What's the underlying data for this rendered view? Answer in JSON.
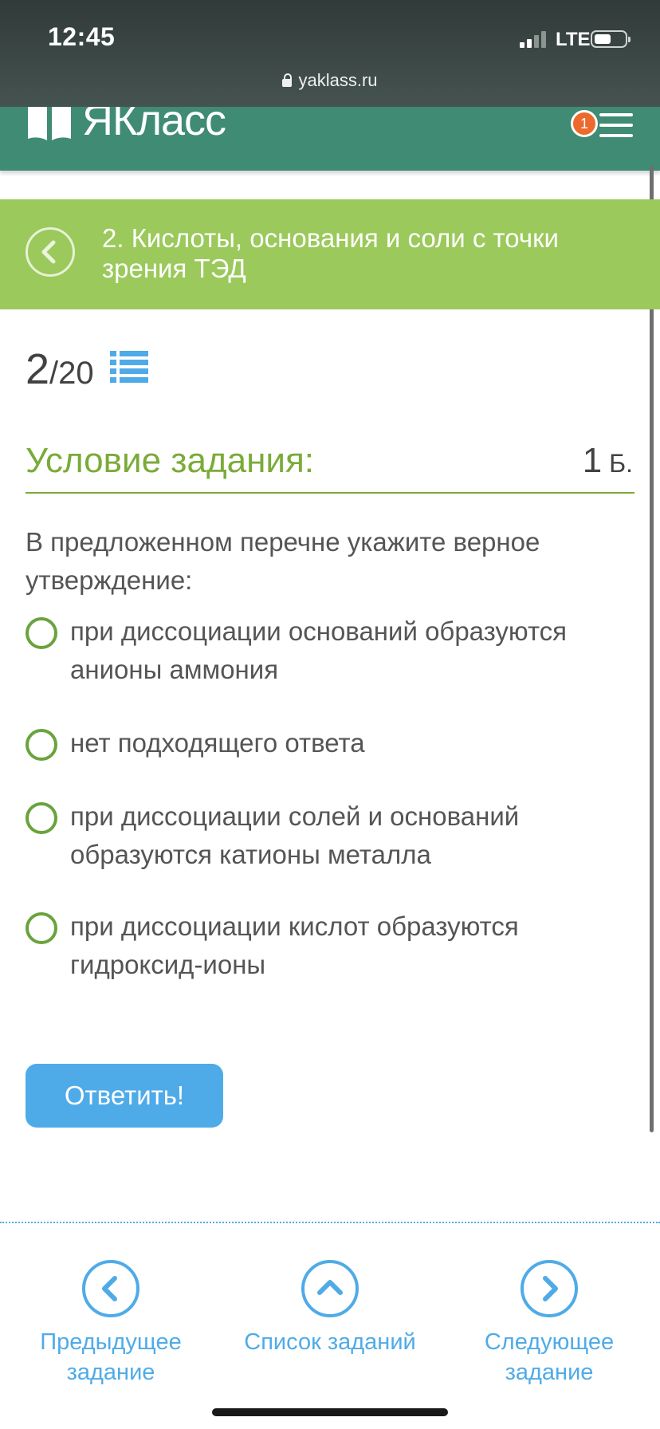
{
  "status_bar": {
    "time": "12:45",
    "network": "LTE"
  },
  "browser": {
    "url": "yaklass.ru"
  },
  "site": {
    "logo_text": "ЯКласс",
    "notification_count": "1",
    "brand_color": "#3f8b73"
  },
  "topic": {
    "title": "2. Кислоты, основания и соли с точки зрения ТЭД",
    "bar_color": "#9bc95b"
  },
  "task": {
    "current": "2",
    "total": "/20"
  },
  "condition": {
    "title": "Условие задания:",
    "points_value": "1",
    "points_unit": " Б."
  },
  "question": {
    "text": "В предложенном перечне укажите верное утверждение:",
    "options": [
      "при диссоциации оснований образуются анионы аммония",
      "нет подходящего ответа",
      "при диссоциации солей и оснований образуются катионы металла",
      "при диссоциации кислот образуются гидроксид-ионы"
    ]
  },
  "actions": {
    "submit_label": "Ответить!"
  },
  "navigation": {
    "prev_line1": "Предыдущее",
    "prev_line2": "задание",
    "list_label": "Список заданий",
    "next_line1": "Следующее",
    "next_line2": "задание"
  },
  "icons": {
    "lock": "lock-icon",
    "back": "chevron-left-icon",
    "list": "list-icon",
    "menu": "hamburger-menu-icon",
    "up": "chevron-up-icon",
    "next": "chevron-right-icon"
  }
}
